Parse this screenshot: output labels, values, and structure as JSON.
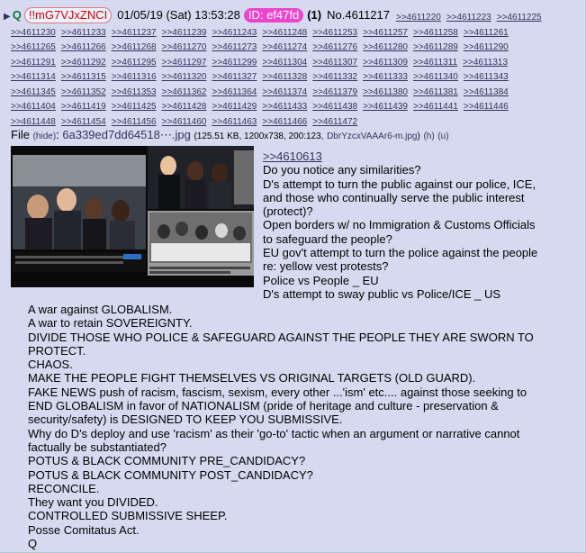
{
  "header": {
    "name": "Q",
    "tripcode": "!!mG7VJxZNCI",
    "datetime": "01/05/19 (Sat) 13:53:28",
    "id_label": "ID: ef47fd",
    "post_count": "(1)",
    "post_no": "No.4611217"
  },
  "replies": [
    "4611220",
    "4611223",
    "4611225",
    "4611230",
    "4611233",
    "4611237",
    "4611239",
    "4611243",
    "4611248",
    "4611253",
    "4611257",
    "4611258",
    "4611261",
    "4611265",
    "4611266",
    "4611268",
    "4611270",
    "4611273",
    "4611274",
    "4611276",
    "4611280",
    "4611289",
    "4611290",
    "4611291",
    "4611292",
    "4611295",
    "4611297",
    "4611299",
    "4611304",
    "4611307",
    "4611309",
    "4611311",
    "4611313",
    "4611314",
    "4611315",
    "4611316",
    "4611320",
    "4611327",
    "4611328",
    "4611332",
    "4611333",
    "4611340",
    "4611343",
    "4611345",
    "4611352",
    "4611353",
    "4611362",
    "4611364",
    "4611374",
    "4611379",
    "4611380",
    "4611381",
    "4611384",
    "4611404",
    "4611419",
    "4611425",
    "4611428",
    "4611429",
    "4611433",
    "4611438",
    "4611439",
    "4611441",
    "4611446",
    "4611448",
    "4611454",
    "4611456",
    "4611460",
    "4611463",
    "4611466",
    "4611472"
  ],
  "file": {
    "label": "File",
    "hide": "(hide)",
    "filename": "6a339ed7dd64518⋯.jpg",
    "meta": "(125.51 KB, 1200x738, 200:123,",
    "orig": "DbrYzcxVAAAr6-m.jpg",
    "h": "(h)",
    "u": "(u)"
  },
  "message": {
    "quote_link": ">>4610613",
    "lines": [
      "Do you notice any similarities?",
      "D's attempt to turn the public against our police, ICE, and those who continually serve the public interest (protect)?",
      "Open borders w/ no Immigration & Customs Officials to safeguard the people?",
      "EU gov't attempt to turn the police against the people re: yellow vest protests?",
      "Police vs People _ EU",
      "D's attempt to sway public vs Police/ICE _ US"
    ]
  },
  "body": {
    "lines": [
      "A war against GLOBALISM.",
      "A war to retain SOVEREIGNTY.",
      "DIVIDE THOSE WHO POLICE & SAFEGUARD AGAINST THE PEOPLE THEY ARE SWORN TO PROTECT.",
      "CHAOS.",
      "MAKE THE PEOPLE FIGHT THEMSELVES VS ORIGINAL TARGETS (OLD GUARD).",
      "FAKE NEWS push of racism, fascism, sexism, every other ...'ism' etc.... against those seeking to END GLOBALISM in favor of NATIONALISM (pride of heritage and culture - preservation & security/safety) is DESIGNED TO KEEP YOU SUBMISSIVE.",
      "Why do D's deploy and use 'racism' as their 'go-to' tactic when an argument or narrative cannot factually be substantiated?",
      "POTUS & BLACK COMMUNITY PRE_CANDIDACY?",
      "POTUS & BLACK COMMUNITY POST_CANDIDACY?",
      "RECONCILE.",
      "They want you DIVIDED.",
      "CONTROLLED SUBMISSIVE SHEEP.",
      "Posse Comitatus Act.",
      "Q"
    ]
  },
  "colors": {
    "post_bg": "#d6daf0",
    "name": "#117743",
    "trip": "#ce0000",
    "id_bg": "#ee44cc",
    "link": "#34345c"
  }
}
